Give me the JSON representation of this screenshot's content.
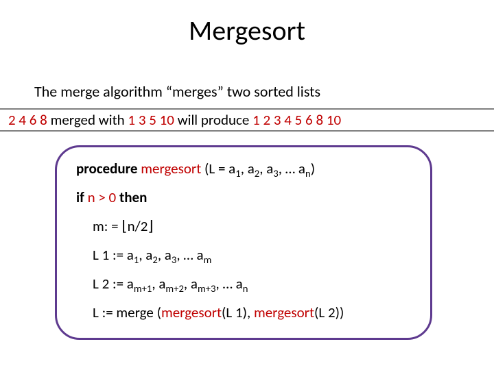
{
  "title": "Mergesort",
  "subtitle": "The merge algorithm “merges” two sorted lists",
  "example": {
    "listA": "2  4  6  8",
    "mergedWith": " merged with ",
    "listB": "1  3  5 10",
    "willProduce": " will produce ",
    "result": "1  2  3  4  5  6  8  10"
  },
  "code": {
    "line1": {
      "kw": "procedure",
      "name": " mergesort ",
      "argsPrefix": "(L = a",
      "argsRest": ", a",
      "argsRest2": ", a",
      "argsDots": ", … a",
      "close": ")"
    },
    "line2": {
      "if": "if ",
      "cond": "n >  0",
      "then": " then"
    },
    "line3": {
      "text": "m: = ",
      "lf": "⌊",
      "expr": "n/2",
      "rf": "⌋"
    },
    "line4": {
      "text": "L 1 :=  a",
      "rest": ", a",
      "rest2": ", a",
      "dots": ", … a"
    },
    "line5": {
      "text": "L 2 :=  a",
      "rest": ", a",
      "rest2": ", a",
      "dots": ", … a"
    },
    "line6": {
      "t1": "L := merge (",
      "ms1": "mergesort",
      "a1": "(L 1), ",
      "ms2": "mergesort",
      "a2": "(L 2))"
    }
  },
  "subs": {
    "s1": "1",
    "s2": "2",
    "s3": "3",
    "sn": "n",
    "sm": "m",
    "mp1": "m+1",
    "mp2": "m+2",
    "mp3": "m+3"
  }
}
